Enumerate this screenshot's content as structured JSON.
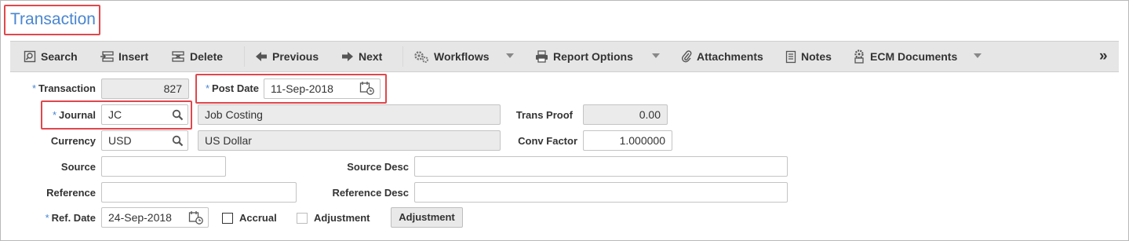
{
  "title": "Transaction",
  "toolbar": {
    "search": "Search",
    "insert": "Insert",
    "delete": "Delete",
    "previous": "Previous",
    "next": "Next",
    "workflows": "Workflows",
    "report_options": "Report Options",
    "attachments": "Attachments",
    "notes": "Notes",
    "ecm_documents": "ECM Documents",
    "more": "»"
  },
  "form": {
    "required_marker": "*",
    "transaction": {
      "label": "Transaction",
      "value": "827"
    },
    "post_date": {
      "label": "Post Date",
      "value": "11-Sep-2018"
    },
    "journal": {
      "label": "Journal",
      "value": "JC",
      "desc": "Job Costing"
    },
    "trans_proof": {
      "label": "Trans Proof",
      "value": "0.00"
    },
    "currency": {
      "label": "Currency",
      "value": "USD",
      "desc": "US Dollar"
    },
    "conv_factor": {
      "label": "Conv Factor",
      "value": "1.000000"
    },
    "source": {
      "label": "Source",
      "value": ""
    },
    "source_desc": {
      "label": "Source Desc",
      "value": ""
    },
    "reference": {
      "label": "Reference",
      "value": ""
    },
    "reference_desc": {
      "label": "Reference Desc",
      "value": ""
    },
    "ref_date": {
      "label": "Ref. Date",
      "value": "24-Sep-2018"
    },
    "accrual": {
      "label": "Accrual",
      "checked": false
    },
    "adjustment": {
      "label": "Adjustment",
      "checked": false,
      "disabled": true
    },
    "adjustment_button": "Adjustment"
  },
  "colors": {
    "accent": "#4a86d1",
    "highlight": "#e0474c",
    "toolbar_bg": "#e6e6e6"
  }
}
